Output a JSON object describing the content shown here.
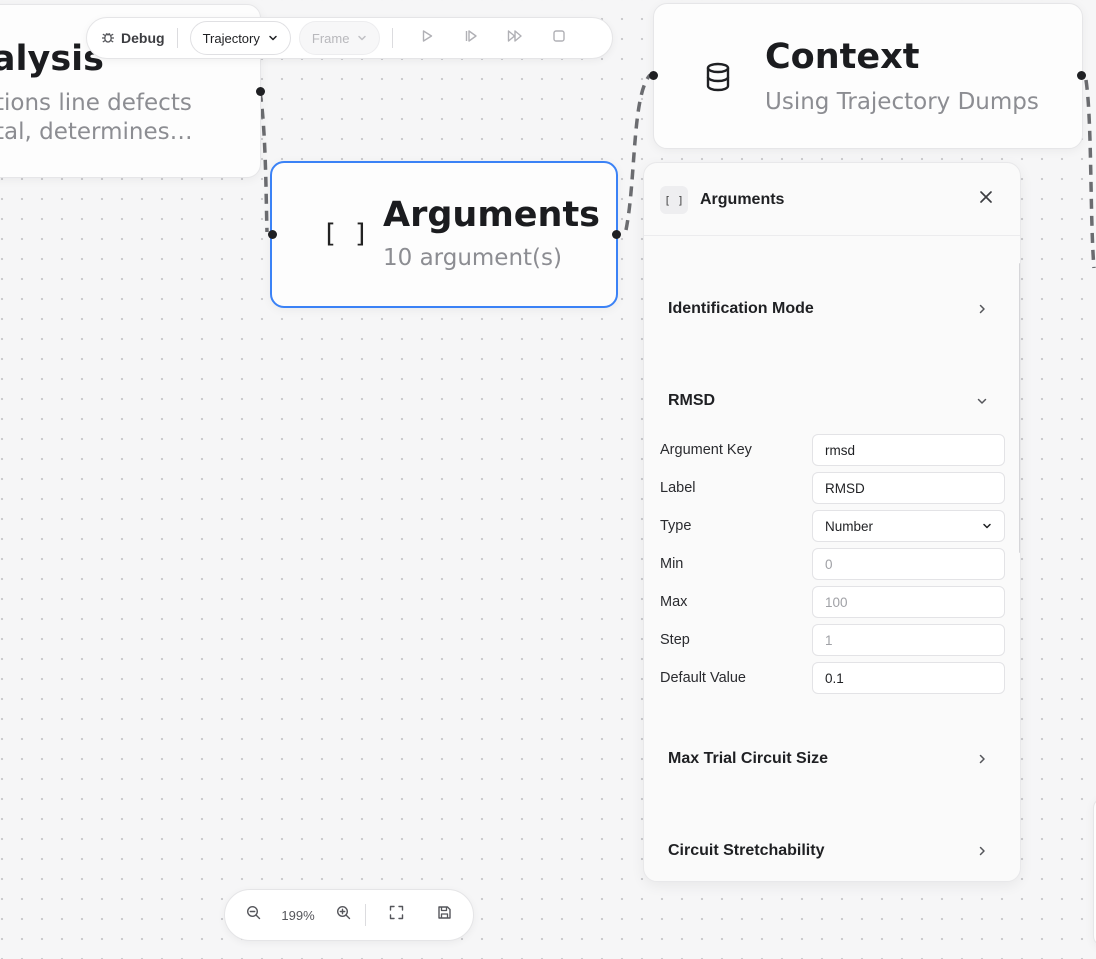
{
  "toolbar": {
    "debug_label": "Debug",
    "trajectory_select": "Trajectory",
    "frame_select": "Frame"
  },
  "nodes": {
    "analysis": {
      "title": "nalysis",
      "subtitle_line1": "tions line defects",
      "subtitle_line2": "tal, determines…"
    },
    "arguments": {
      "icon": "[ ]",
      "title": "Arguments",
      "subtitle": "10 argument(s)"
    },
    "context": {
      "icon": "database-icon",
      "title": "Context",
      "subtitle": "Using Trajectory Dumps"
    }
  },
  "panel": {
    "icon": "[ ]",
    "title": "Arguments",
    "sections": [
      {
        "label": "Identification Mode",
        "expanded": false
      },
      {
        "label": "RMSD",
        "expanded": true
      },
      {
        "label": "Max Trial Circuit Size",
        "expanded": false
      },
      {
        "label": "Circuit Stretchability",
        "expanded": false
      }
    ],
    "rmsd_fields": {
      "argument_key": {
        "label": "Argument Key",
        "value": "rmsd"
      },
      "label": {
        "label": "Label",
        "value": "RMSD"
      },
      "type": {
        "label": "Type",
        "value": "Number"
      },
      "min": {
        "label": "Min",
        "placeholder": "0"
      },
      "max": {
        "label": "Max",
        "placeholder": "100"
      },
      "step": {
        "label": "Step",
        "placeholder": "1"
      },
      "default_value": {
        "label": "Default Value",
        "value": "0.1"
      }
    }
  },
  "zoom": {
    "level": "199%"
  },
  "colors": {
    "selected_border": "#3b82f6",
    "canvas_bg": "#f6f6f7"
  }
}
